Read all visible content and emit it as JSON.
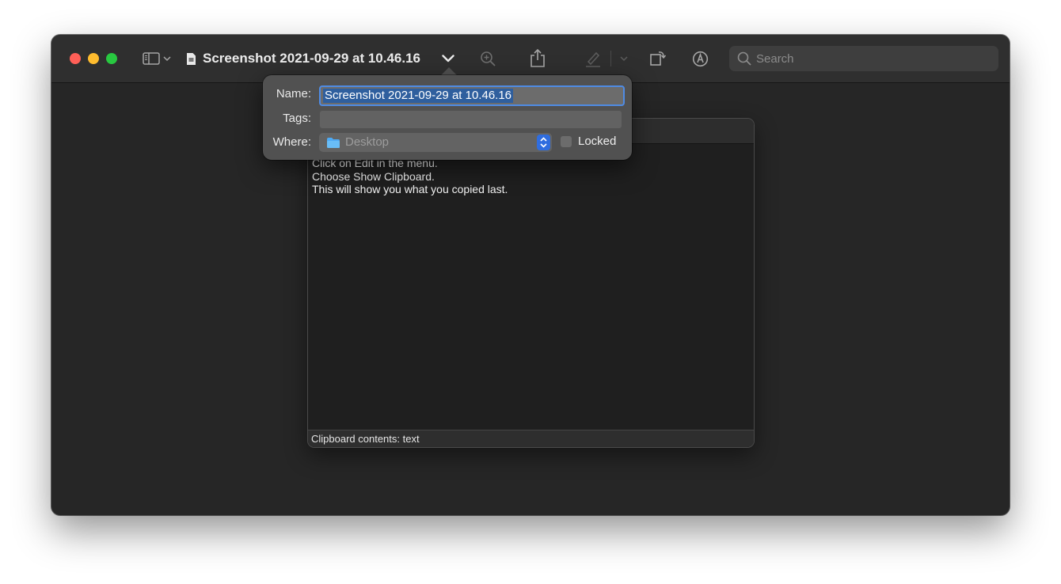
{
  "window": {
    "title": "Screenshot 2021-09-29 at 10.46.16"
  },
  "toolbar": {
    "search_placeholder": "Search"
  },
  "icons": {
    "close": "close-button",
    "minimize": "minimize-button",
    "zoom": "zoom-button",
    "sidebar": "sidebar-icon",
    "sidebar_chevron": "chevron-down-icon",
    "document": "document-icon",
    "title_chevron": "chevron-down-icon",
    "zoom_in": "zoom-in-icon",
    "share": "share-icon",
    "highlight": "highlighter-icon",
    "highlight_chevron": "chevron-down-icon",
    "rotate": "rotate-icon",
    "markup": "markup-pen-icon",
    "search": "search-icon",
    "folder": "folder-icon",
    "stepper": "up-down-stepper-icon"
  },
  "colors": {
    "close": "#ff5f57",
    "minimize": "#febc2e",
    "zoom": "#28c840",
    "accent": "#2f6ddf",
    "folder": "#4eaaf4"
  },
  "popover": {
    "name_label": "Name:",
    "name_value": "Screenshot 2021-09-29 at 10.46.16",
    "tags_label": "Tags:",
    "tags_value": "",
    "where_label": "Where:",
    "where_value": "Desktop",
    "locked_label": "Locked",
    "locked_checked": false
  },
  "clipboard": {
    "lines": [
      "Click on Edit in the menu.",
      "Choose Show Clipboard.",
      "This will show you what you copied last."
    ],
    "status": "Clipboard contents: text"
  }
}
